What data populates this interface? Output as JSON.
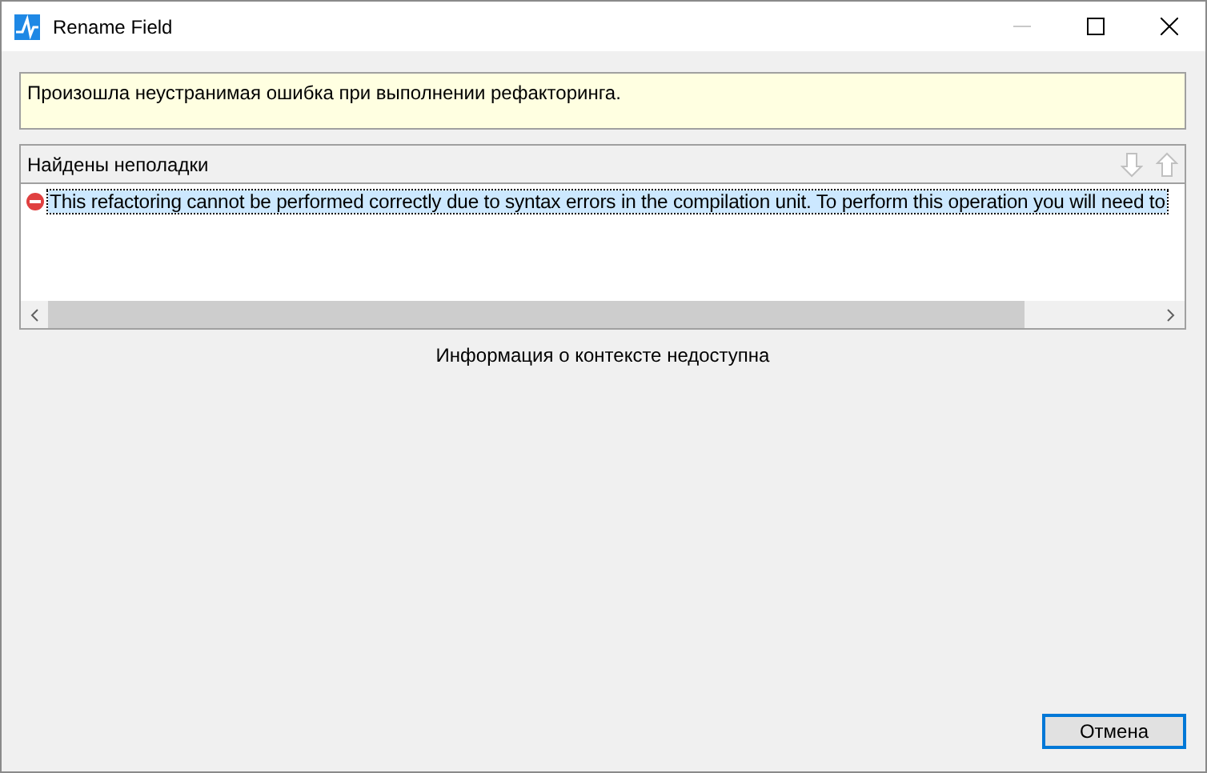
{
  "window": {
    "title": "Rename Field",
    "controls": [
      {
        "kind": "minimize",
        "disabled": true
      },
      {
        "kind": "maximize",
        "disabled": false
      },
      {
        "kind": "close",
        "disabled": false
      }
    ]
  },
  "message": "Произошла неустранимая ошибка при выполнении рефакторинга.",
  "problems": {
    "title": "Найдены неполадки",
    "nav_buttons": [
      {
        "kind": "down",
        "disabled": true
      },
      {
        "kind": "up",
        "disabled": true
      }
    ],
    "items": [
      {
        "kind": "error",
        "text": "This refactoring cannot be performed correctly due to syntax errors in the compilation unit. To perform this operation you will need to",
        "selected": true
      }
    ]
  },
  "context_info": "Информация о контексте недоступна",
  "buttons": [
    {
      "label": "Отмена",
      "default": true
    }
  ]
}
